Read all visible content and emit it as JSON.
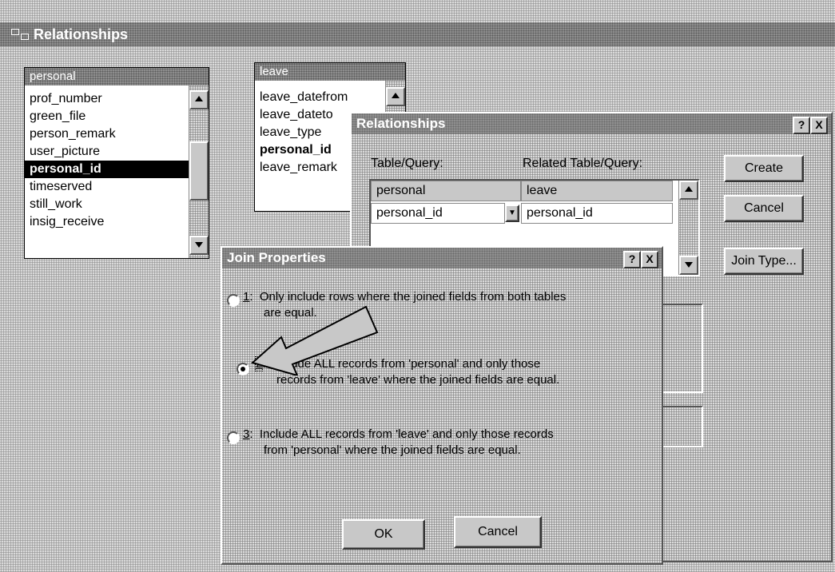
{
  "window": {
    "title": "Relationships"
  },
  "tables": [
    {
      "title": "personal",
      "fields": [
        "prof_number",
        "green_file",
        "person_remark",
        "user_picture",
        "personal_id",
        "timeserved",
        "still_work",
        "insig_receive"
      ],
      "selected": "personal_id"
    },
    {
      "title": "leave",
      "fields": [
        "leave_datefrom",
        "leave_dateto",
        "leave_type",
        "personal_id",
        "leave_remark"
      ],
      "bold": "personal_id"
    }
  ],
  "relationships_dialog": {
    "title": "Relationships",
    "help": "?",
    "close": "X",
    "table_label": "Table/Query:",
    "related_label": "Related Table/Query:",
    "table_value": "personal",
    "related_value": "leave",
    "table_field": "personal_id",
    "related_field": "personal_id",
    "buttons": {
      "create": "Create",
      "cancel": "Cancel",
      "join_type": "Join Type..."
    }
  },
  "join_dialog": {
    "title": "Join Properties",
    "help": "?",
    "close": "X",
    "options": [
      {
        "key": "1",
        "line1": "Only include rows where the joined fields from both tables",
        "line2": "are equal.",
        "selected": false
      },
      {
        "key": "2",
        "line1": "Include ALL records from 'personal' and only those",
        "line2": "records from 'leave' where the joined fields are equal.",
        "selected": true
      },
      {
        "key": "3",
        "line1": "Include ALL records from 'leave' and only those records",
        "line2": "from 'personal' where the joined fields are equal.",
        "selected": false
      }
    ],
    "ok": "OK",
    "cancel": "Cancel"
  }
}
